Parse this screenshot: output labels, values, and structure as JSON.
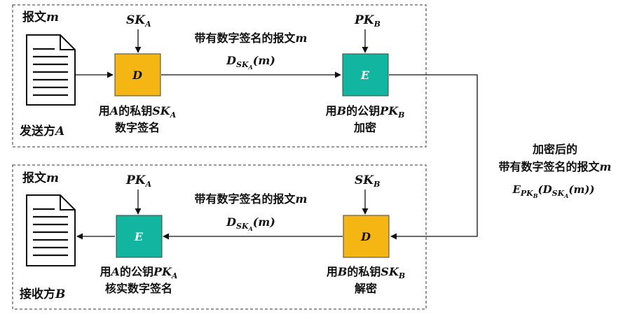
{
  "sender": {
    "name": "发送方",
    "name_var": "A",
    "message": {
      "label": "报文",
      "var": "m"
    },
    "sign_box": {
      "letter": "D",
      "color": "#F5B614"
    },
    "sign_key": {
      "base": "SK",
      "sub": "A"
    },
    "sign_caption": {
      "line1_a": "用",
      "line1_var": "A",
      "line1_b": "的私钥",
      "key_base": "SK",
      "key_sub": "A",
      "line2": "数字签名"
    },
    "signed_label": {
      "text": "带有数字签名的报文",
      "var": "m"
    },
    "signed_formula": {
      "func": "D",
      "sub_base": "SK",
      "sub_sub": "A",
      "arg": "(m)"
    },
    "encrypt_box": {
      "letter": "E",
      "color": "#12B5A0"
    },
    "encrypt_key": {
      "base": "PK",
      "sub": "B"
    },
    "encrypt_caption": {
      "line1_a": "用",
      "line1_var": "B",
      "line1_b": "的公钥",
      "key_base": "PK",
      "key_sub": "B",
      "line2": "加密"
    }
  },
  "channel": {
    "line1": "加密后的",
    "line2_text": "带有数字签名的报文",
    "line2_var": "m",
    "formula": {
      "E": "E",
      "E_sub_base": "PK",
      "E_sub_sub": "B",
      "D": "(D",
      "D_sub_base": "SK",
      "D_sub_sub": "A",
      "arg": "(m))"
    }
  },
  "receiver": {
    "name": "接收方",
    "name_var": "B",
    "message": {
      "label": "报文",
      "var": "m"
    },
    "decrypt_box": {
      "letter": "D",
      "color": "#F5B614"
    },
    "decrypt_key": {
      "base": "SK",
      "sub": "B"
    },
    "decrypt_caption": {
      "line1_a": "用",
      "line1_var": "B",
      "line1_b": "的私钥",
      "key_base": "SK",
      "key_sub": "B",
      "line2": "解密"
    },
    "signed_label": {
      "text": "带有数字签名的报文",
      "var": "m"
    },
    "signed_formula": {
      "func": "D",
      "sub_base": "SK",
      "sub_sub": "A",
      "arg": "(m)"
    },
    "verify_box": {
      "letter": "E",
      "color": "#12B5A0"
    },
    "verify_key": {
      "base": "PK",
      "sub": "A"
    },
    "verify_caption": {
      "line1_a": "用",
      "line1_var": "A",
      "line1_b": "的公钥",
      "key_base": "PK",
      "key_sub": "A",
      "line2": "核实数字签名"
    }
  }
}
